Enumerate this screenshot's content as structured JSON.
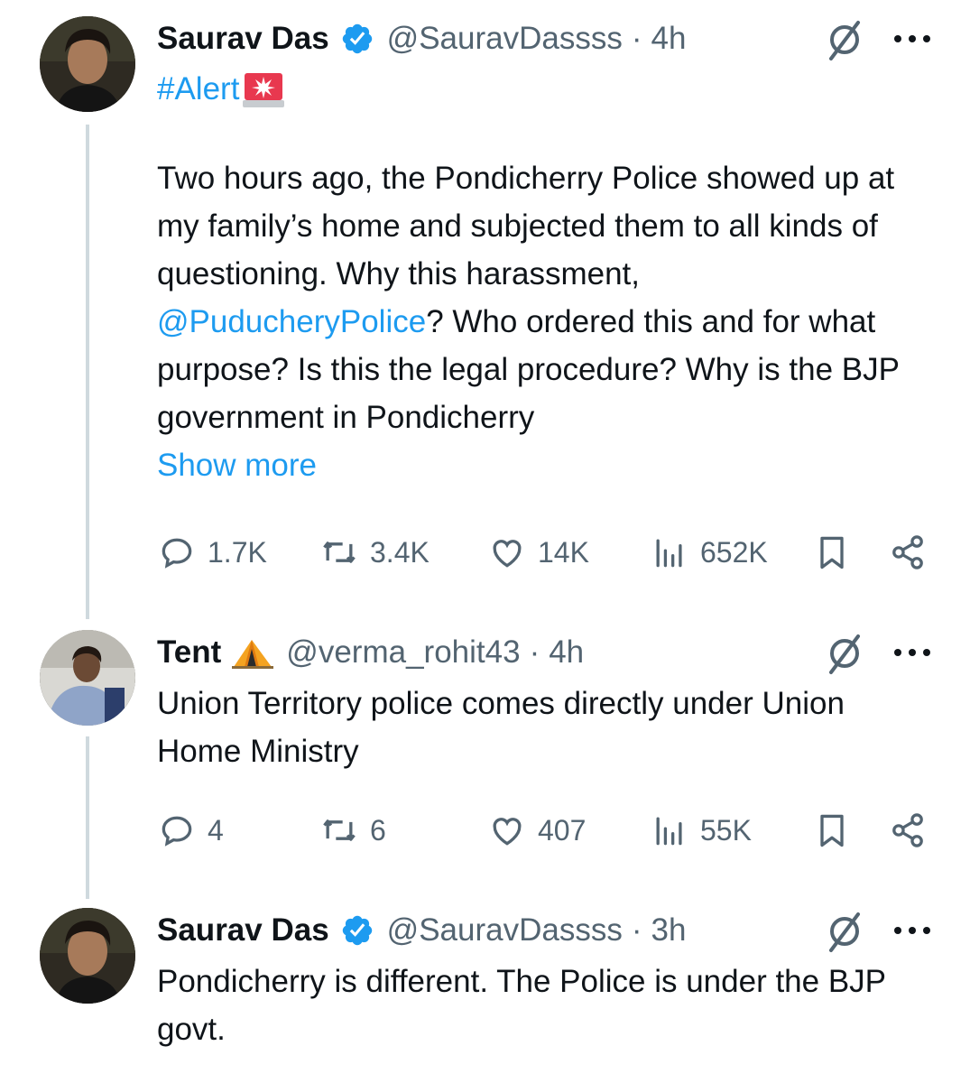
{
  "tweets": [
    {
      "author_name": "Saurav Das",
      "verified": true,
      "handle": "@SauravDassss",
      "dot": "·",
      "time": "4h",
      "hashtag": "#Alert",
      "text_before_mention": "Two hours ago, the Pondicherry Police showed up at my family’s home and subjected them to all kinds of questioning. Why this harassment, ",
      "mention": "@PuducheryPolice",
      "text_after_mention": "? Who ordered this and for what purpose? Is this the legal procedure? Why is the BJP government in Pondicherry",
      "show_more": "Show more",
      "stats": {
        "replies": "1.7K",
        "reposts": "3.4K",
        "likes": "14K",
        "views": "652K"
      }
    },
    {
      "author_name": "Tent",
      "verified": false,
      "handle": "@verma_rohit43",
      "dot": "·",
      "time": "4h",
      "text": "Union Territory police comes directly under Union Home Ministry",
      "stats": {
        "replies": "4",
        "reposts": "6",
        "likes": "407",
        "views": "55K"
      }
    },
    {
      "author_name": "Saurav Das",
      "verified": true,
      "handle": "@SauravDassss",
      "dot": "·",
      "time": "3h",
      "text": "Pondicherry is different. The Police is under the BJP govt."
    }
  ],
  "icons": {
    "verified": "verified-badge-icon",
    "grok": "grok-icon",
    "more": "more-icon",
    "reply": "reply-icon",
    "repost": "repost-icon",
    "like": "like-icon",
    "views": "views-icon",
    "bookmark": "bookmark-icon",
    "share": "share-icon",
    "siren": "siren-emoji-icon",
    "tent": "tent-emoji-icon"
  },
  "colors": {
    "link": "#1d9bf0",
    "muted": "#536471",
    "text": "#0f1419",
    "thread_line": "#cfd9de"
  }
}
